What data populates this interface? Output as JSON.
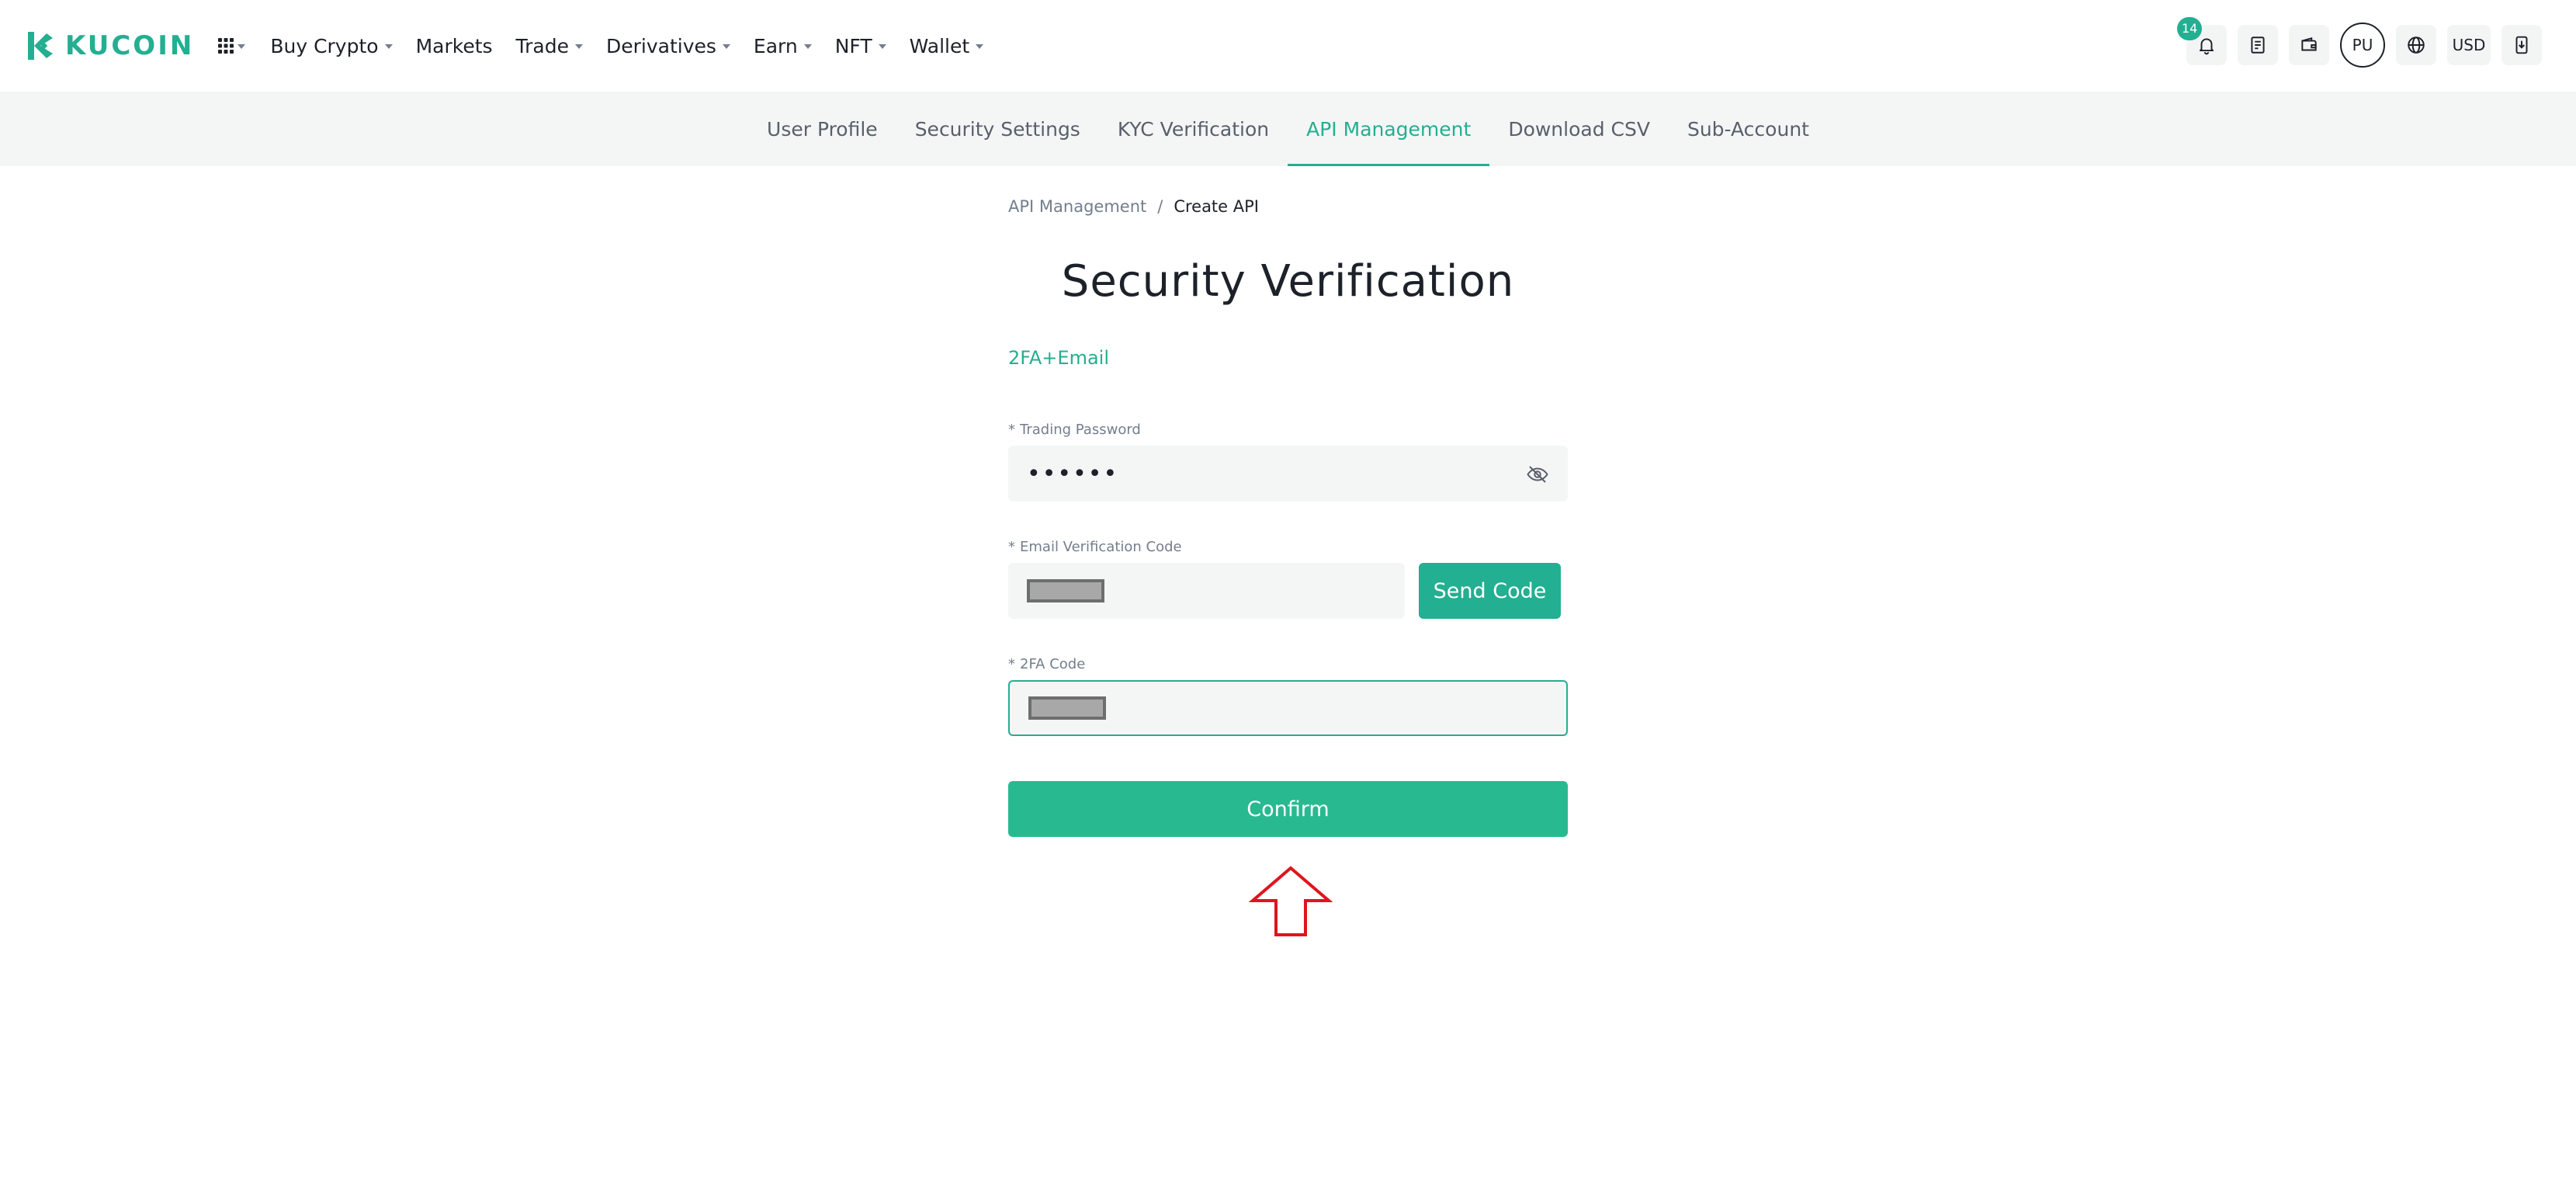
{
  "brand": {
    "name": "KUCOIN",
    "color": "#23af91"
  },
  "topnav": {
    "apps_icon": "grid-icon",
    "items": [
      {
        "label": "Buy Crypto",
        "dropdown": true
      },
      {
        "label": "Markets",
        "dropdown": false
      },
      {
        "label": "Trade",
        "dropdown": true
      },
      {
        "label": "Derivatives",
        "dropdown": true
      },
      {
        "label": "Earn",
        "dropdown": true
      },
      {
        "label": "NFT",
        "dropdown": true
      },
      {
        "label": "Wallet",
        "dropdown": true
      }
    ],
    "right": {
      "notification_count": "14",
      "avatar_initials": "PU",
      "currency": "USD",
      "icons": [
        "bell-icon",
        "orders-icon",
        "wallet-icon",
        "globe-icon",
        "download-icon"
      ]
    }
  },
  "subnav": {
    "tabs": [
      {
        "label": "User Profile",
        "active": false
      },
      {
        "label": "Security Settings",
        "active": false
      },
      {
        "label": "KYC Verification",
        "active": false
      },
      {
        "label": "API Management",
        "active": true
      },
      {
        "label": "Download CSV",
        "active": false
      },
      {
        "label": "Sub-Account",
        "active": false
      }
    ]
  },
  "breadcrumb": {
    "parent": "API Management",
    "separator": "/",
    "current": "Create API"
  },
  "form": {
    "title": "Security Verification",
    "method": "2FA+Email",
    "required_mark": "*",
    "trading_password": {
      "label": "Trading Password",
      "value": "••••••"
    },
    "email_code": {
      "label": "Email Verification Code",
      "send_label": "Send Code"
    },
    "twofa_code": {
      "label": "2FA Code"
    },
    "confirm_label": "Confirm"
  },
  "colors": {
    "accent": "#23af91",
    "annotation_arrow": "#e0141e",
    "subnav_bg": "#f4f6f6"
  }
}
